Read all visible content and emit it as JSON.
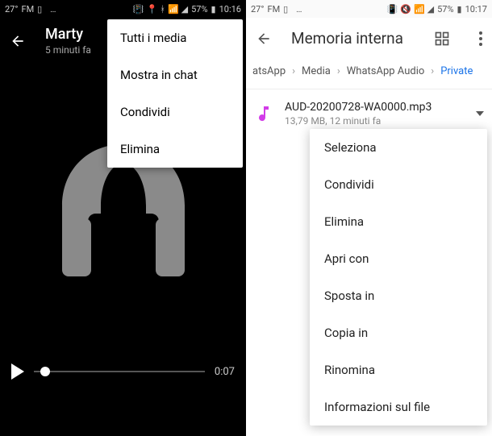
{
  "left": {
    "status": {
      "temp": "27°",
      "fm": "FM",
      "battery": "57%",
      "time": "10:16"
    },
    "header": {
      "title": "Marty",
      "subtitle": "5 minuti fa"
    },
    "menu": {
      "items": [
        {
          "label": "Tutti i media"
        },
        {
          "label": "Mostra in chat"
        },
        {
          "label": "Condividi"
        },
        {
          "label": "Elimina"
        }
      ]
    },
    "player": {
      "time": "0:07"
    }
  },
  "right": {
    "status": {
      "temp": "27°",
      "fm": "FM",
      "battery": "57%",
      "time": "10:17"
    },
    "header": {
      "title": "Memoria interna"
    },
    "crumbs": {
      "c0": "atsApp",
      "c1": "Media",
      "c2": "WhatsApp Audio",
      "c3": "Private"
    },
    "file": {
      "name": "AUD-20200728-WA0000.mp3",
      "meta": "13,79 MB, 12 minuti fa"
    },
    "menu": {
      "items": [
        {
          "label": "Seleziona"
        },
        {
          "label": "Condividi"
        },
        {
          "label": "Elimina"
        },
        {
          "label": "Apri con"
        },
        {
          "label": "Sposta in"
        },
        {
          "label": "Copia in"
        },
        {
          "label": "Rinomina"
        },
        {
          "label": "Informazioni sul file"
        }
      ]
    }
  }
}
